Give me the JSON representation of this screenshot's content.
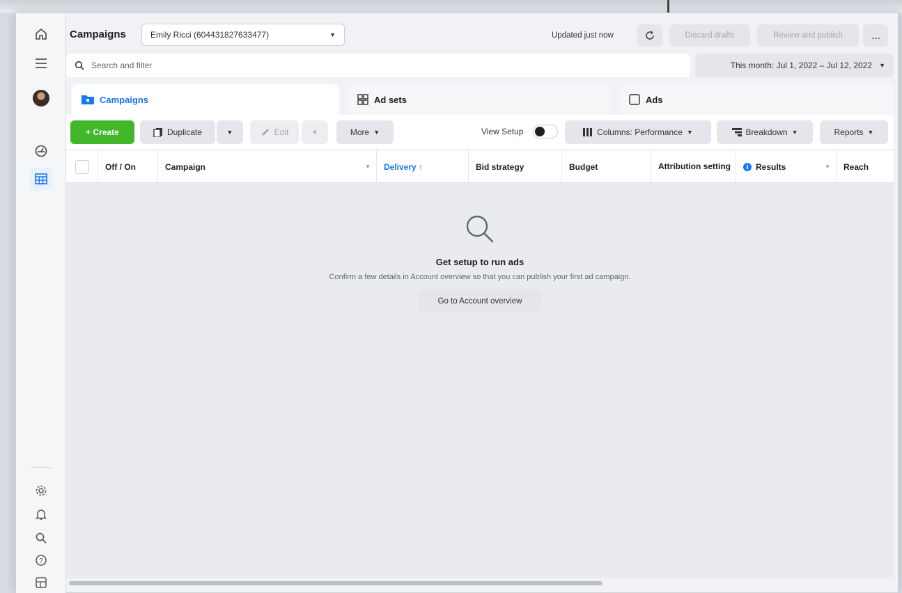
{
  "header": {
    "title": "Campaigns",
    "account": "Emily Ricci (604431827633477)",
    "updated": "Updated just now",
    "discard_label": "Discard drafts",
    "review_label": "Review and publish",
    "more_label": "…"
  },
  "search": {
    "placeholder": "Search and filter"
  },
  "date_range": {
    "label": "This month: Jul 1, 2022 – Jul 12, 2022"
  },
  "tabs": [
    {
      "label": "Campaigns",
      "icon": "folder-icon"
    },
    {
      "label": "Ad sets",
      "icon": "grid-icon"
    },
    {
      "label": "Ads",
      "icon": "square-icon"
    }
  ],
  "toolbar": {
    "create_label": "+ Create",
    "duplicate_label": "Duplicate",
    "edit_label": "Edit",
    "more_label": "More",
    "view_setup_label": "View Setup",
    "columns_label": "Columns: Performance",
    "breakdown_label": "Breakdown",
    "reports_label": "Reports"
  },
  "table": {
    "columns": [
      "Off / On",
      "Campaign",
      "Delivery ↑",
      "Bid strategy",
      "Budget",
      "Attribution setting",
      "Results",
      "Reach"
    ]
  },
  "empty_state": {
    "title": "Get setup to run ads",
    "message": "Confirm a few details in Account overview so that you can publish your first ad campaign.",
    "button": "Go to Account overview"
  },
  "colors": {
    "accent": "#1877f2",
    "create_green": "#42b72a"
  }
}
